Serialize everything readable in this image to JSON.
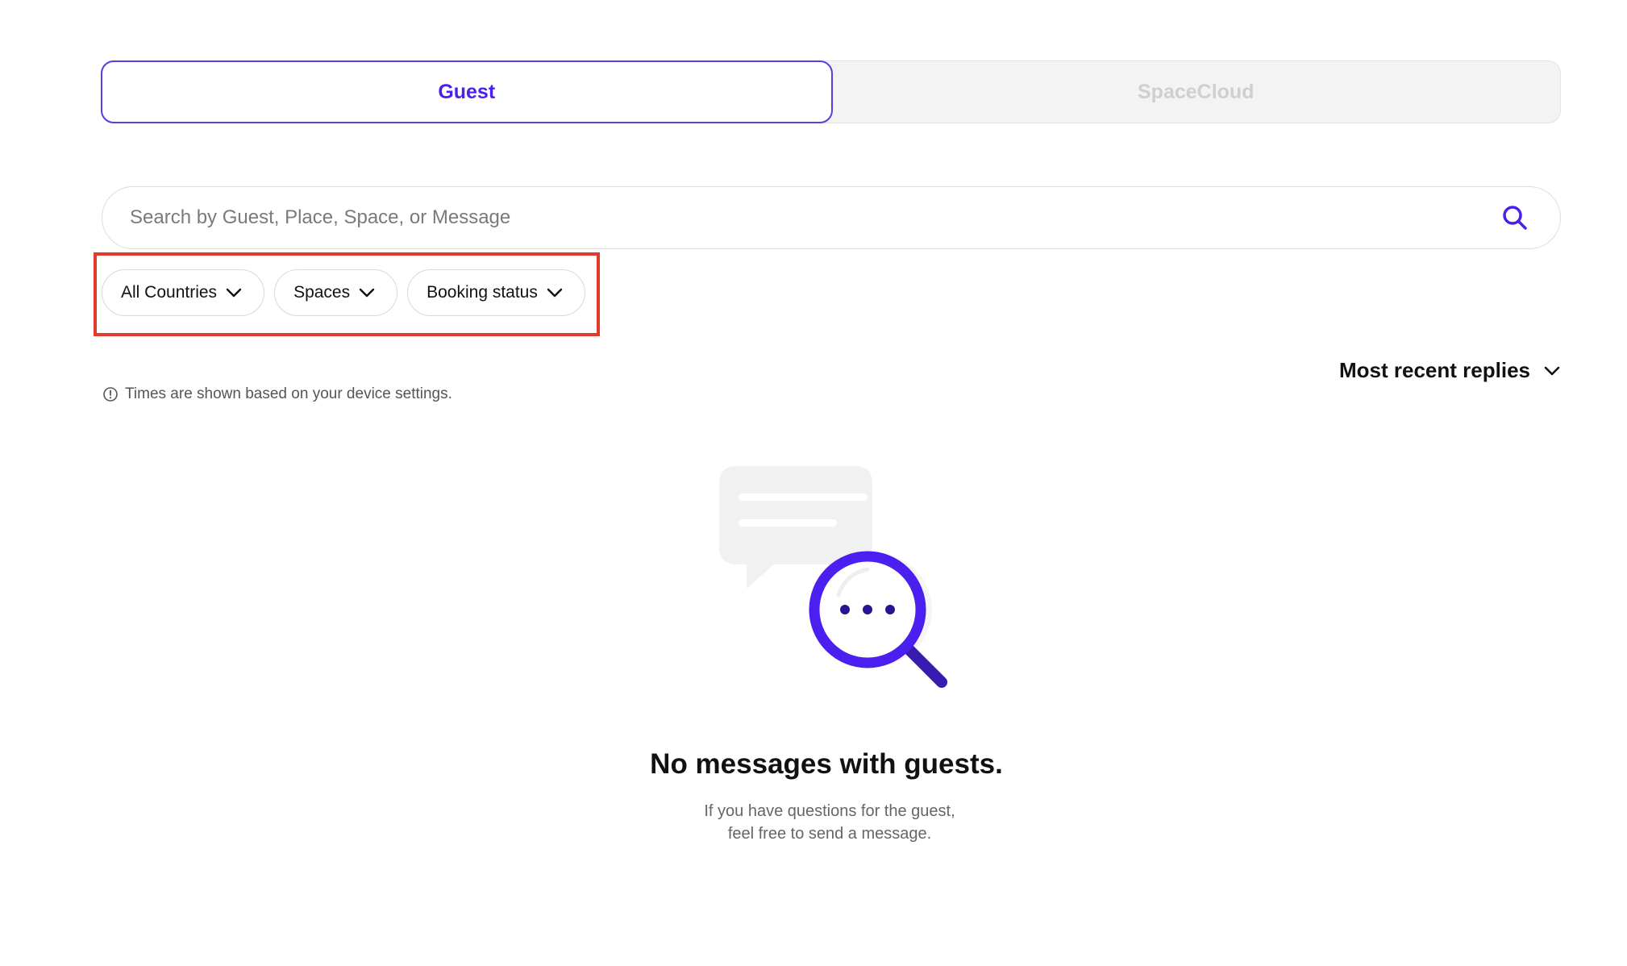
{
  "tabs": [
    {
      "label": "Guest",
      "active": true
    },
    {
      "label": "SpaceCloud",
      "active": false
    }
  ],
  "search": {
    "placeholder": "Search by Guest, Place, Space, or Message",
    "icon": "search-icon"
  },
  "filters": [
    {
      "label": "All Countries",
      "icon": "chevron-down-icon"
    },
    {
      "label": "Spaces",
      "icon": "chevron-down-icon"
    },
    {
      "label": "Booking status",
      "icon": "chevron-down-icon"
    }
  ],
  "sort": {
    "label": "Most recent replies",
    "icon": "chevron-down-icon"
  },
  "info": {
    "text": "Times are shown based on your device settings.",
    "icon": "info-icon"
  },
  "empty_state": {
    "title": "No messages with guests.",
    "subtitle_line1": "If you have questions for the guest,",
    "subtitle_line2": "feel free to send a message.",
    "illustration": "message-search-illustration"
  },
  "colors": {
    "accent": "#4a1ff0",
    "highlight_outline": "#e33a2b"
  }
}
